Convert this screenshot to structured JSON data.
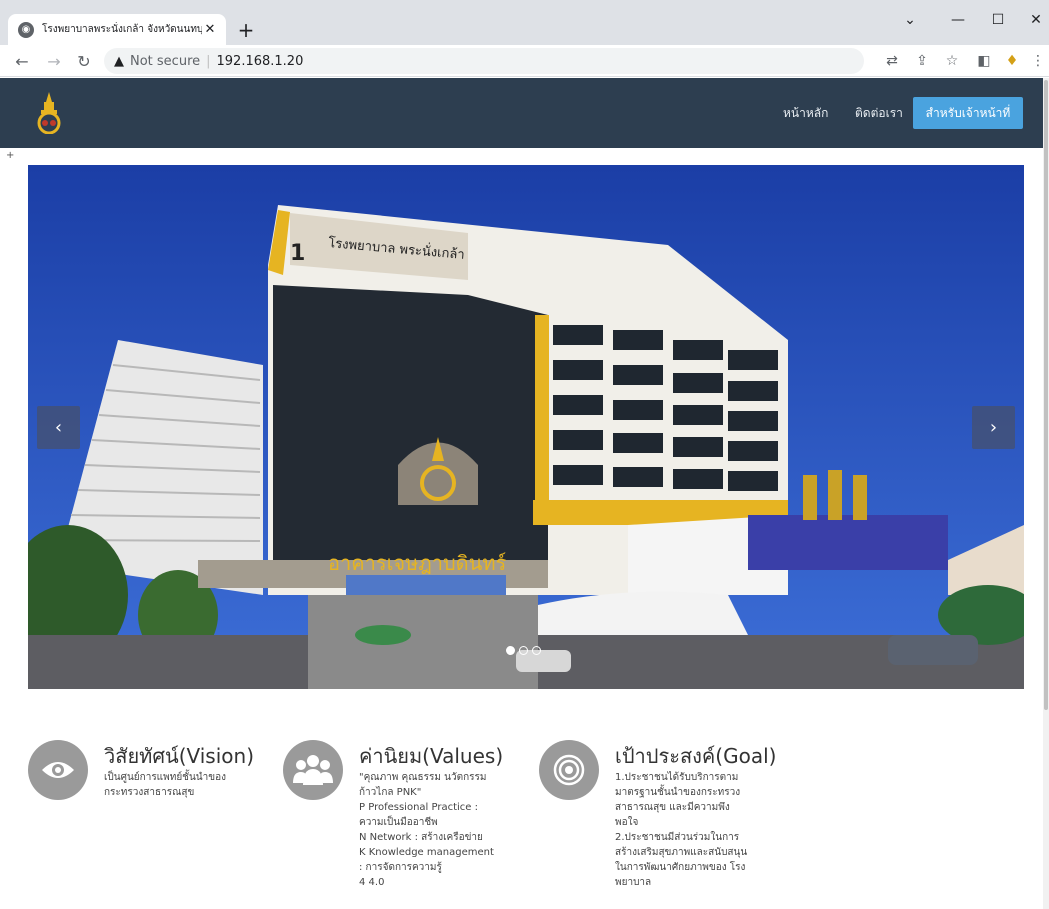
{
  "browser": {
    "tab_title": "โรงพยาบาลพระนั่งเกล้า จังหวัดนนทบุรี",
    "tab_close": "✕",
    "new_tab": "+",
    "win_min": "—",
    "win_max": "☐",
    "win_close": "✕",
    "win_chevron": "⌄",
    "not_secure": "Not secure",
    "url": "192.168.1.20"
  },
  "nav": {
    "home": "หน้าหลัก",
    "contact": "ติดต่อเรา",
    "staff": "สำหรับเจ้าหน้าที่"
  },
  "carousel": {
    "prev": "‹",
    "next": "›",
    "slides": 3,
    "active_slide": 1,
    "sign_building": "โรงพยาบาล พระนั่งเกล้า",
    "sign_main": "อาคารเจษฎาบดินทร์",
    "number": "1"
  },
  "vision": {
    "title": "วิสัยทัศน์(Vision)",
    "lines": [
      "เป็นศูนย์การแพทย์ชั้นนำของ",
      "กระทรวงสาธารณสุข"
    ]
  },
  "values": {
    "title": "ค่านิยม(Values)",
    "lines": [
      "\"คุณภาพ คุณธรรม นวัตกรรม",
      "ก้าวไกล PNK\"",
      "P  Professional Practice :",
      "ความเป็นมืออาชีพ",
      "N  Network : สร้างเครือข่าย",
      "K  Knowledge management",
      ": การจัดการความรู้",
      "4  4.0"
    ]
  },
  "goal": {
    "title": "เป้าประสงค์(Goal)",
    "lines": [
      "1.ประชาชนได้รับบริการตาม",
      "มาตรฐานชั้นนำของกระทรวง",
      "สาธารณสุข และมีความพึง",
      "พอใจ",
      "2.ประชาชนมีส่วนร่วมในการ",
      "สร้างเสริมสุขภาพและสนับสนุน",
      "ในการพัฒนาศักยภาพของ โรง",
      "พยาบาล"
    ]
  },
  "colors": {
    "navbar": "#2d3e50",
    "cta": "#4aa3df",
    "icon_circle": "#9a9a9a"
  }
}
